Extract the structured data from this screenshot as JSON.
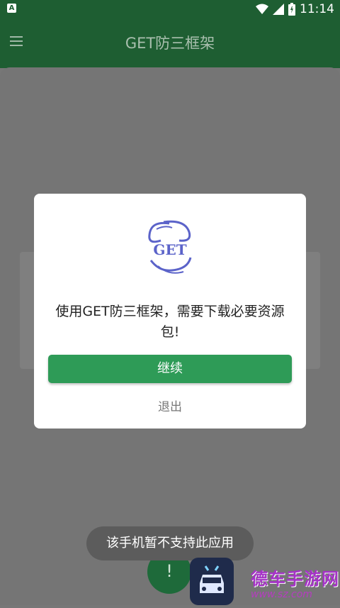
{
  "status_bar": {
    "left_icon": "A",
    "time": "11:14",
    "icons": [
      "wifi-icon",
      "signal-icon",
      "battery-icon"
    ]
  },
  "app_bar": {
    "title": "GET防三框架",
    "menu_icon": "menu-icon"
  },
  "dialog": {
    "logo_letters": "GET",
    "message": "使用GET防三框架，需要下载必要资源包!",
    "continue_label": "继续",
    "exit_label": "退出"
  },
  "toast": {
    "text": "该手机暂不支持此应用"
  },
  "watermark": {
    "text": "德车手游网",
    "url": "www.sz.com"
  },
  "colors": {
    "app_bar": "#1e5e32",
    "button": "#2e9b57",
    "toast": "#5c5c5c"
  }
}
